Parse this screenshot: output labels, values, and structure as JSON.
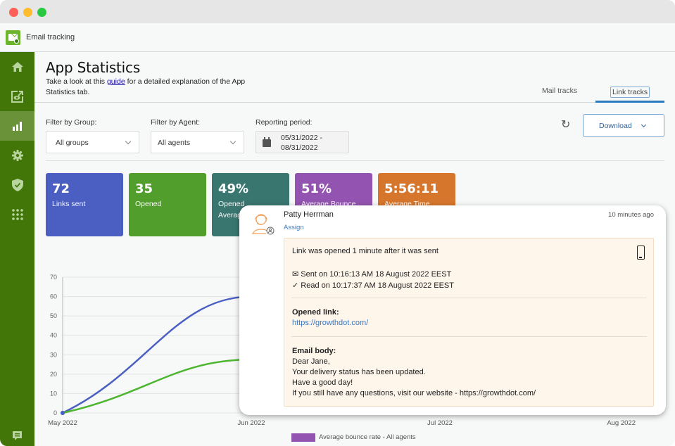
{
  "window": {
    "app_title": "Email tracking"
  },
  "sidebar": {
    "items": [
      {
        "icon": "home-icon",
        "label": "Home",
        "active": false
      },
      {
        "icon": "eye-tracking-icon",
        "label": "Tracking",
        "active": false
      },
      {
        "icon": "bar-chart-icon",
        "label": "App Statistics",
        "active": true
      },
      {
        "icon": "gear-icon",
        "label": "Settings",
        "active": false
      },
      {
        "icon": "shield-check-icon",
        "label": "Security",
        "active": false
      },
      {
        "icon": "apps-grid-icon",
        "label": "Apps",
        "active": false
      }
    ],
    "bottom_icon": "chat-icon"
  },
  "header": {
    "title": "App Statistics",
    "subtitle_prefix": "Take a look at this ",
    "subtitle_link": "guide",
    "subtitle_suffix": " for a detailed explanation of the App Statistics tab."
  },
  "tabs": [
    {
      "label": "Mail tracks",
      "active": false
    },
    {
      "label": "Link tracks",
      "active": true
    }
  ],
  "filters": {
    "group": {
      "label": "Filter by Group:",
      "value": "All groups"
    },
    "agent": {
      "label": "Filter by Agent:",
      "value": "All agents"
    },
    "period": {
      "label": "Reporting period:",
      "start": "05/31/2022 -",
      "end": "08/31/2022"
    }
  },
  "toolbar": {
    "refresh_icon": "refresh-icon",
    "download_label": "Download"
  },
  "cards": [
    {
      "value": "72",
      "label": "Links sent",
      "color": "#4a5fc1"
    },
    {
      "value": "35",
      "label": "Opened",
      "color": "#519e2c"
    },
    {
      "value": "49%",
      "label": "Opened Average Rate",
      "color": "#3a7670"
    },
    {
      "value": "51%",
      "label": "Average Bounce",
      "color": "#9254b0"
    },
    {
      "value": "5:56:11",
      "label": "Average Time",
      "color": "#d5762c"
    }
  ],
  "chart_data": {
    "type": "line",
    "x": [
      "May 2022",
      "Jun 2022",
      "Jul 2022",
      "Aug 2022"
    ],
    "ylim": [
      0,
      70
    ],
    "yticks": [
      0,
      10,
      20,
      30,
      40,
      50,
      60,
      70
    ],
    "series": [
      {
        "name": "Links sent",
        "color": "#4a5fc1",
        "values": [
          0,
          60,
          null,
          null
        ]
      },
      {
        "name": "Opened",
        "color": "#4db52f",
        "values": [
          0,
          27.5,
          null,
          null
        ]
      }
    ],
    "legend": [
      {
        "label": "Average bounce rate - All agents",
        "color": "#9254b0"
      }
    ],
    "legend_position": "bottom",
    "grid": true
  },
  "notification": {
    "name": "Patty Herrman",
    "assign_label": "Assign",
    "time": "10 minutes ago",
    "headline": "Link was opened 1 minute after it was sent",
    "sent": "✉ Sent on 10:16:13 AM 18 August 2022 EEST",
    "read": "✓ Read on 10:17:37 AM 18 August 2022 EEST",
    "opened_link_label": "Opened link:",
    "opened_link": "https://growthdot.com/",
    "body_label": "Email body:",
    "body_lines": [
      "Dear Jane,",
      "Your delivery status has been updated.",
      "Have a good day!",
      "If you still have any questions, visit our website - https://growthdot.com/"
    ],
    "device_icon": "mobile-phone-icon"
  }
}
